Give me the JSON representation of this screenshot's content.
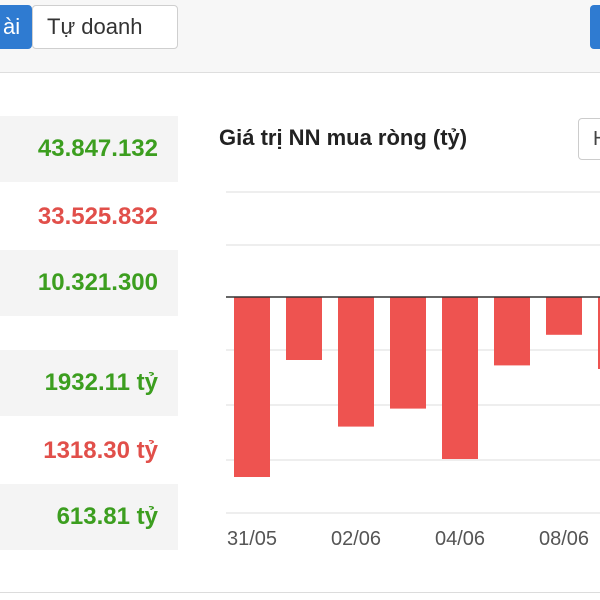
{
  "tabs": {
    "active_label": "ài",
    "inactive_label": "Tự doanh"
  },
  "stats": {
    "rows": [
      {
        "value": "43.847.132",
        "color": "green"
      },
      {
        "value": "33.525.832",
        "color": "red"
      },
      {
        "value": "10.321.300",
        "color": "green"
      },
      {
        "value": "1932.11 tỷ",
        "color": "green"
      },
      {
        "value": "1318.30 tỷ",
        "color": "red"
      },
      {
        "value": "613.81 tỷ",
        "color": "green"
      }
    ]
  },
  "chart": {
    "title": "Giá trị NN mua ròng (tỷ)",
    "select_value": "H"
  },
  "chart_data": {
    "type": "bar",
    "title": "Giá trị NN mua ròng (tỷ)",
    "tick_labels": [
      "31/05",
      "02/06",
      "04/06",
      "08/06"
    ],
    "values": [
      -100,
      -35,
      -72,
      -62,
      -90,
      -38,
      -21,
      -40
    ],
    "bar_color": "#ee5350"
  },
  "colors": {
    "accent": "#2f7bd1",
    "positive": "#3c9e1f",
    "negative": "#e14f4a"
  }
}
